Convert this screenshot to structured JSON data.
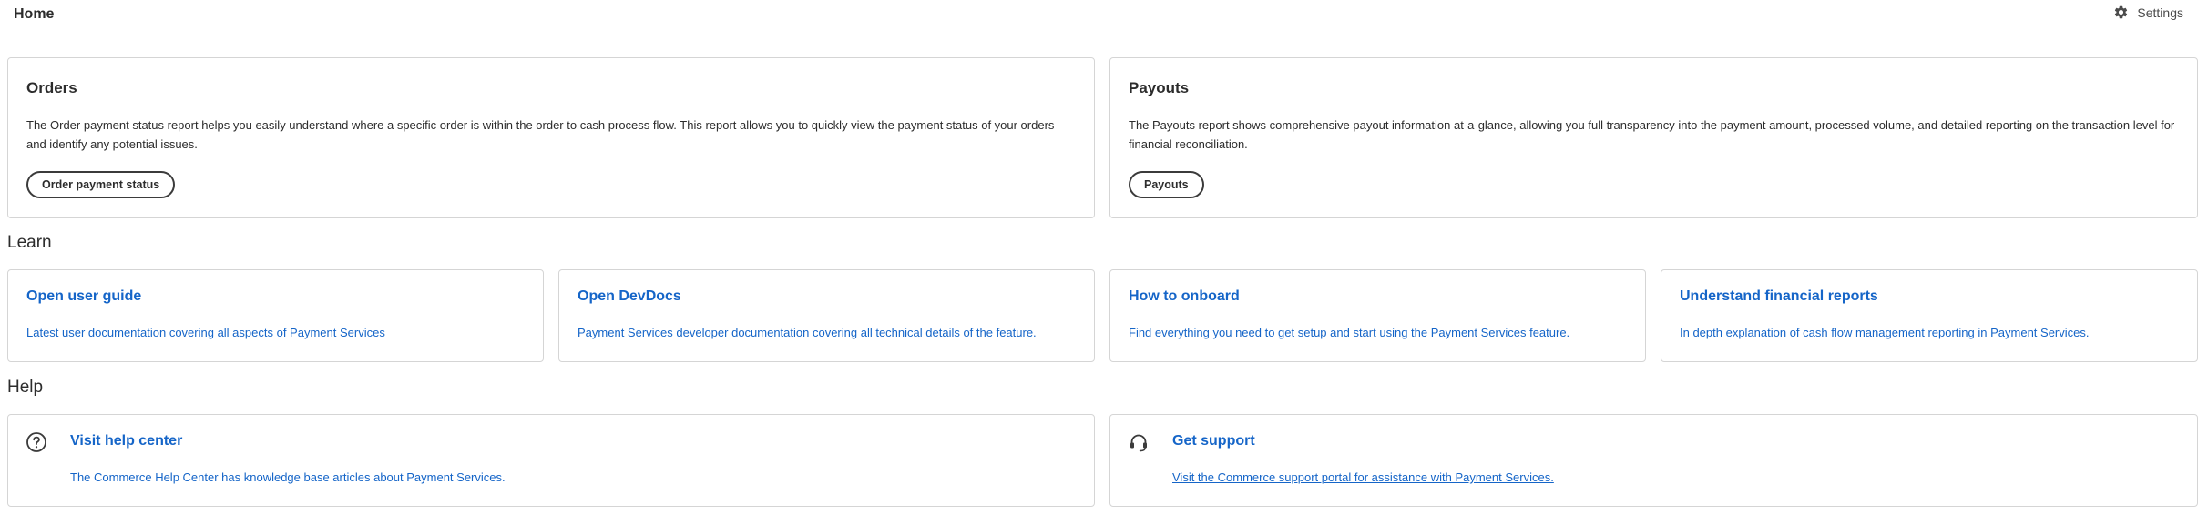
{
  "header": {
    "title": "Home",
    "settings_label": "Settings",
    "settings_icon": "gear-icon"
  },
  "reports": [
    {
      "title": "Orders",
      "description": "The Order payment status report helps you easily understand where a specific order is within the order to cash process flow. This report allows you to quickly view the payment status of your orders and identify any potential issues.",
      "button_label": "Order payment status"
    },
    {
      "title": "Payouts",
      "description": "The Payouts report shows comprehensive payout information at-a-glance, allowing you full transparency into the payment amount, processed volume, and detailed reporting on the transaction level for financial reconciliation.",
      "button_label": "Payouts"
    }
  ],
  "learn": {
    "heading": "Learn",
    "items": [
      {
        "title": "Open user guide",
        "description": "Latest user documentation covering all aspects of Payment Services"
      },
      {
        "title": "Open DevDocs",
        "description": "Payment Services developer documentation covering all technical details of the feature."
      },
      {
        "title": "How to onboard",
        "description": "Find everything you need to get setup and start using the Payment Services feature."
      },
      {
        "title": "Understand financial reports",
        "description": "In depth explanation of cash flow management reporting in Payment Services."
      }
    ]
  },
  "help": {
    "heading": "Help",
    "items": [
      {
        "title": "Visit help center",
        "description": "The Commerce Help Center has knowledge base articles about Payment Services.",
        "icon": "question-circle-icon"
      },
      {
        "title": "Get support",
        "description": "Visit the Commerce support portal for assistance with Payment Services.",
        "icon": "headset-icon"
      }
    ]
  },
  "colors": {
    "link": "#1565c8",
    "border": "#d5d5d5",
    "text": "#2c2c2c"
  }
}
